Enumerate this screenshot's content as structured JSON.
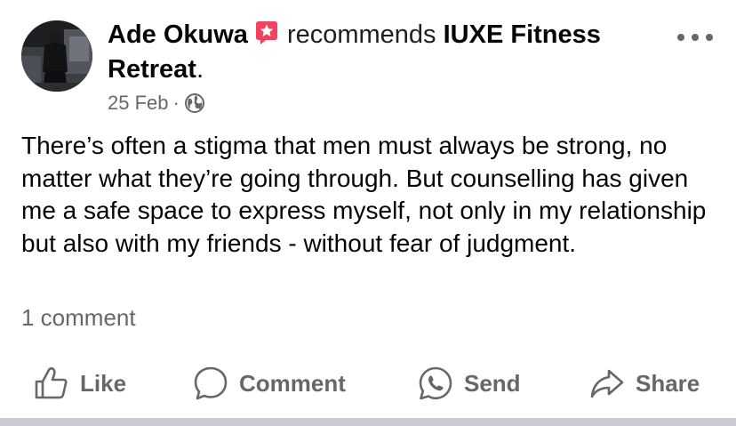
{
  "post": {
    "author": "Ade Okuwa",
    "badge_icon": "recommend-star-icon",
    "verb": "recommends",
    "page_name": "IUXE Fitness Retreat",
    "trailing_punct": ".",
    "date": "25 Feb",
    "separator": "·",
    "audience_icon": "globe-icon",
    "body": "There’s often a stigma that men must always be strong, no matter what they’re going through. But counselling has given me a safe space to express myself, not only in my relationship but also with my friends - without fear of judgment.",
    "comment_count": "1 comment"
  },
  "actions": {
    "like": "Like",
    "comment": "Comment",
    "send": "Send",
    "share": "Share"
  },
  "colors": {
    "text_primary": "#050505",
    "text_secondary": "#65676b",
    "badge_pink": "#f3425f",
    "divider": "#c9ccd1"
  }
}
